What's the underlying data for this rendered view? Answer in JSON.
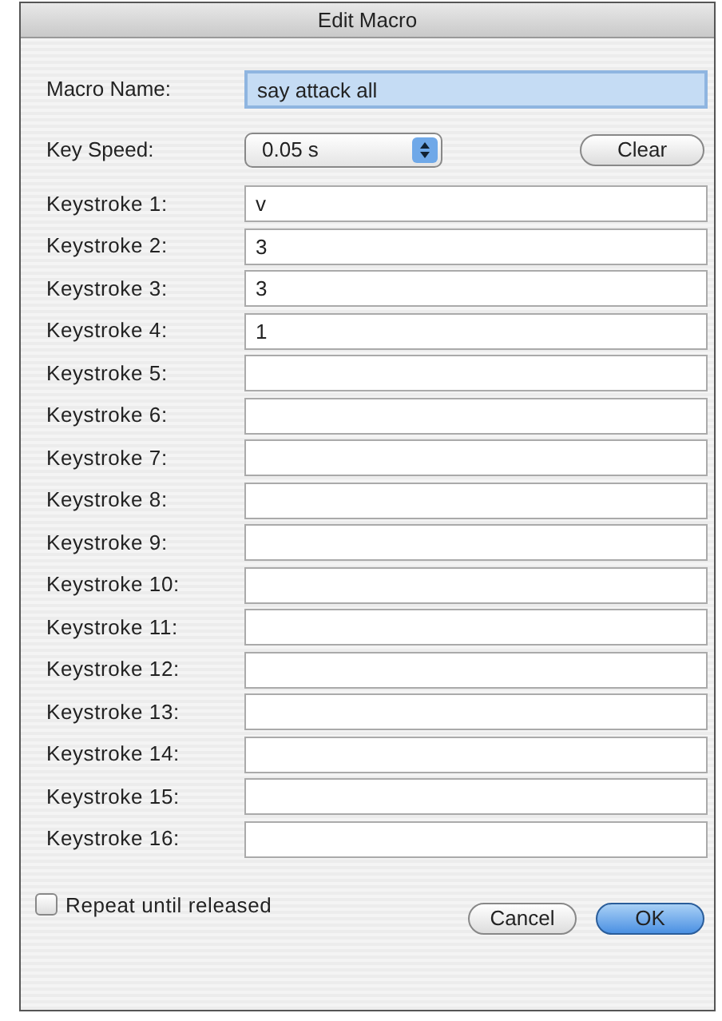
{
  "window": {
    "title": "Edit Macro"
  },
  "macro_name": {
    "label": "Macro Name:",
    "value": "say attack all",
    "focused": true
  },
  "key_speed": {
    "label": "Key Speed:",
    "value": "0.05 s"
  },
  "clear_button": "Clear",
  "keystrokes": [
    {
      "label": "Keystroke 1:",
      "value": "v"
    },
    {
      "label": "Keystroke 2:",
      "value": "3"
    },
    {
      "label": "Keystroke 3:",
      "value": "3"
    },
    {
      "label": "Keystroke 4:",
      "value": "1"
    },
    {
      "label": "Keystroke 5:"
    },
    {
      "label": "Keystroke 6:"
    },
    {
      "label": "Keystroke 7:"
    },
    {
      "label": "Keystroke 8:"
    },
    {
      "label": "Keystroke 9:"
    },
    {
      "label": "Keystroke 10:"
    },
    {
      "label": "Keystroke 11:"
    },
    {
      "label": "Keystroke 12:"
    },
    {
      "label": "Keystroke 13:"
    },
    {
      "label": "Keystroke 14:"
    },
    {
      "label": "Keystroke 15:"
    },
    {
      "label": "Keystroke 16:"
    }
  ],
  "repeat": {
    "label": "Repeat until released",
    "checked": false
  },
  "buttons": [
    {
      "label": "Cancel",
      "default": false
    },
    {
      "label": "OK",
      "default": true
    }
  ]
}
